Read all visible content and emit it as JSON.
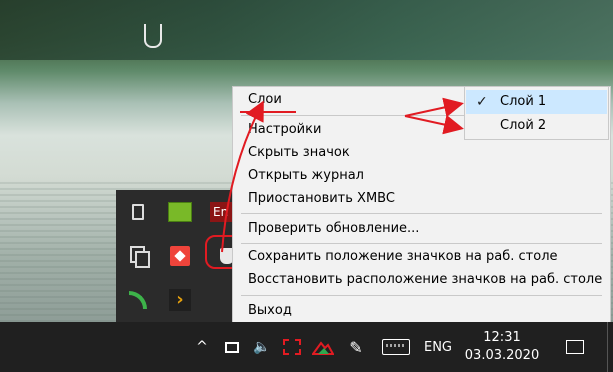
{
  "desktop": {},
  "tray_flyout": {
    "icons": [
      "usb-icon",
      "nvidia-icon",
      "en-icon",
      "copy-icon",
      "anydesk-icon",
      "xmbc-icon",
      "rss-icon",
      "plex-icon"
    ],
    "en_label": "En",
    "plex_label": "›"
  },
  "context_menu": {
    "layers": "Слои",
    "settings": "Настройки",
    "hide_icon": "Скрыть значок",
    "open_log": "Открыть журнал",
    "pause": "Приостановить XMBC",
    "check_update": "Проверить обновление...",
    "save_positions": "Сохранить положение значков на раб. столе",
    "restore_positions": "Восстановить расположение значков на раб. столе",
    "exit": "Выход"
  },
  "submenu": {
    "items": [
      {
        "label": "Слой 1",
        "checked": true
      },
      {
        "label": "Слой 2",
        "checked": false
      }
    ],
    "check_glyph": "✓"
  },
  "taskbar": {
    "chevron": "^",
    "volume": "🔈",
    "pen": "✎",
    "language": "ENG",
    "time": "12:31",
    "date": "03.03.2020"
  },
  "colors": {
    "annotation_red": "#e11b22",
    "menu_bg": "#f2f2f2",
    "selection": "#cce8ff",
    "taskbar": "#202020"
  }
}
